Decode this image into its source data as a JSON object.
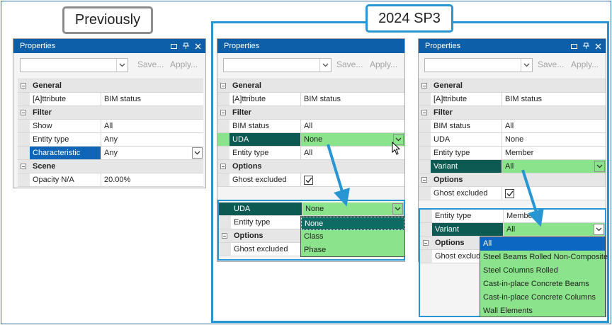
{
  "callouts": {
    "previously": "Previously",
    "sp3": "2024 SP3"
  },
  "panel": {
    "title": "Properties",
    "save": "Save...",
    "apply": "Apply..."
  },
  "colors": {
    "header_blue": "#0c5fa8",
    "frame_blue": "#2796d3",
    "highlight_green": "#8be48b",
    "highlight_dark": "#0d5a52",
    "selection_blue": "#0f66b8"
  },
  "previously": {
    "cat_general": "General",
    "attribute_label": "[A]ttribute",
    "attribute_value": "BIM status",
    "cat_filter": "Filter",
    "show_label": "Show",
    "show_value": "All",
    "entity_label": "Entity type",
    "entity_value": "Any",
    "char_label": "Characteristic",
    "char_value": "Any",
    "cat_scene": "Scene",
    "opacity_label": "Opacity N/A",
    "opacity_value": "20.00%"
  },
  "middle": {
    "cat_general": "General",
    "attribute_label": "[A]ttribute",
    "attribute_value": "BIM status",
    "cat_filter": "Filter",
    "bim_label": "BIM status",
    "bim_value": "All",
    "uda_label": "UDA",
    "uda_value": "None",
    "entity_label": "Entity type",
    "entity_value": "All",
    "cat_options": "Options",
    "ghost_label": "Ghost excluded",
    "zoom": {
      "uda_label": "UDA",
      "uda_value": "None",
      "entity_label": "Entity type",
      "cat_options": "Options",
      "ghost_label": "Ghost excluded",
      "options": [
        "None",
        "Class",
        "Phase"
      ]
    }
  },
  "right": {
    "cat_general": "General",
    "attribute_label": "[A]ttribute",
    "attribute_value": "BIM status",
    "cat_filter": "Filter",
    "bim_label": "BIM status",
    "bim_value": "All",
    "uda_label": "UDA",
    "uda_value": "None",
    "entity_label": "Entity type",
    "entity_value": "Member",
    "variant_label": "Variant",
    "variant_value": "All",
    "cat_options": "Options",
    "ghost_label": "Ghost excluded",
    "zoom": {
      "entity_label": "Entity type",
      "entity_value": "Member",
      "variant_label": "Variant",
      "variant_value": "All",
      "cat_options": "Options",
      "ghost_label": "Ghost exclud",
      "options": [
        "All",
        "Steel Beams Rolled Non-Composite",
        "Steel Columns Rolled",
        "Cast-in-place Concrete Beams",
        "Cast-in-place Concrete Columns",
        "Wall Elements"
      ]
    }
  }
}
